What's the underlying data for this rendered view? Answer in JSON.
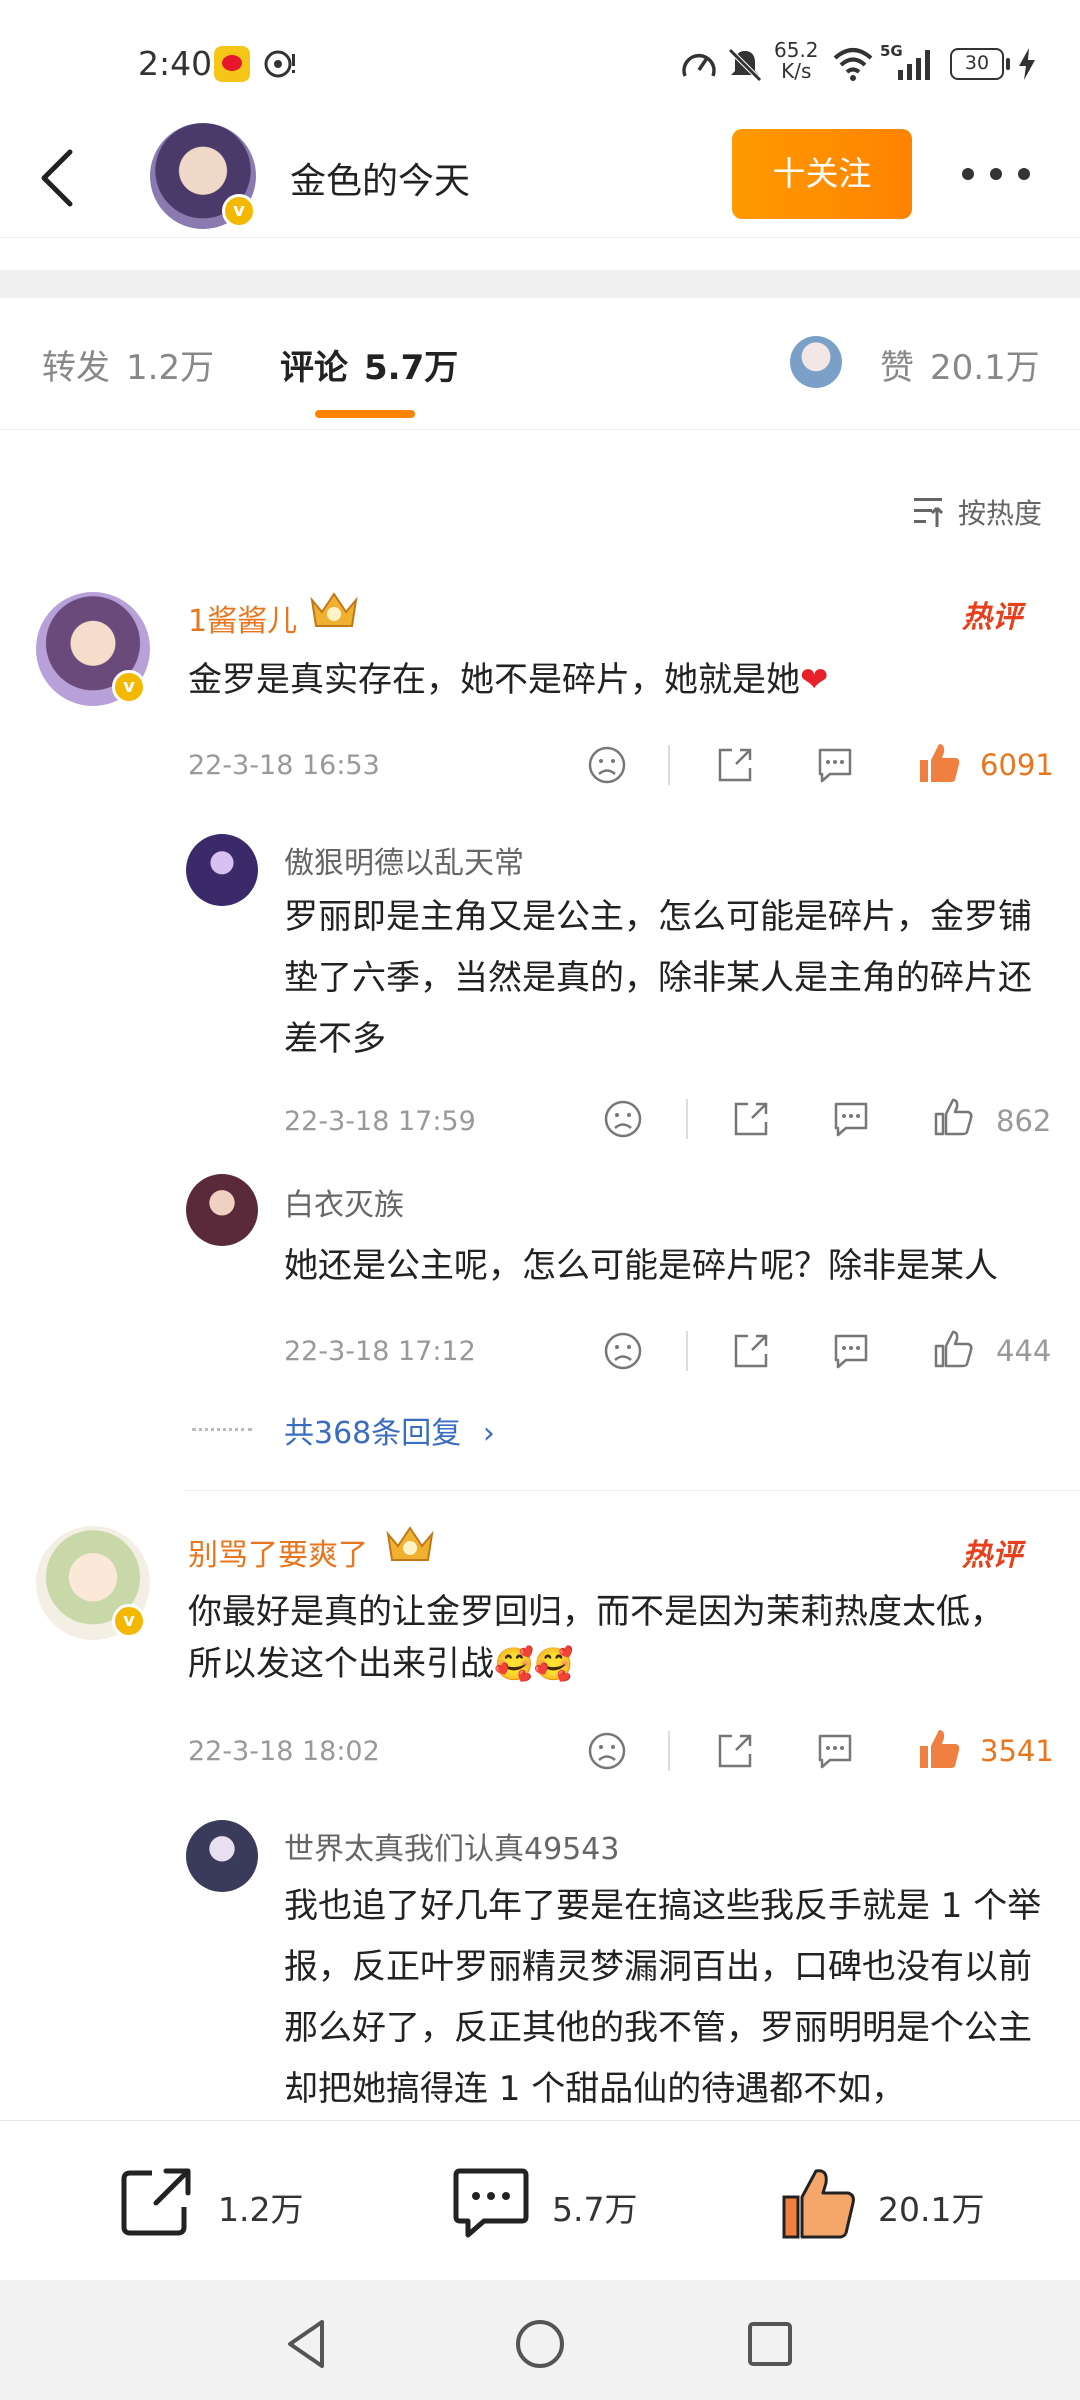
{
  "status_bar": {
    "time": "2:40",
    "net_speed_value": "65.2",
    "net_speed_unit": "K/s",
    "signal_type": "5G",
    "battery": "30"
  },
  "header": {
    "username": "金色的今天",
    "follow_label": "十关注"
  },
  "tabs": {
    "repost_label": "转发",
    "repost_count": "1.2万",
    "comment_label": "评论",
    "comment_count": "5.7万",
    "like_label": "赞",
    "like_count": "20.1万"
  },
  "sort_label": "按热度",
  "hot_badge": "热评",
  "comments": [
    {
      "name": "1酱酱儿",
      "text": "金罗是真实存在，她不是碎片，她就是她",
      "time": "22-3-18  16:53",
      "likes": "6091",
      "replies": [
        {
          "name": "傲狠明德以乱天常",
          "text": "罗丽即是主角又是公主，怎么可能是碎片，金罗铺垫了六季，当然是真的，除非某人是主角的碎片还差不多",
          "time": "22-3-18  17:59",
          "likes": "862"
        },
        {
          "name": "白衣灭族",
          "text": "她还是公主呢，怎么可能是碎片呢？除非是某人",
          "time": "22-3-18  17:12",
          "likes": "444"
        }
      ],
      "more_replies": "共368条回复"
    },
    {
      "name": "别骂了要爽了",
      "text": "你最好是真的让金罗回归，而不是因为茉莉热度太低，所以发这个出来引战",
      "time": "22-3-18  18:02",
      "likes": "3541",
      "replies": [
        {
          "name": "世界太真我们认真49543",
          "text": "我也追了好几年了要是在搞这些我反手就是 1 个举报，反正叶罗丽精灵梦漏洞百出，口碑也没有以前那么好了，反正其他的我不管，罗丽明明是个公主却把她搞得连 1 个甜品仙的待遇都不如，"
        }
      ]
    }
  ],
  "bottom_bar": {
    "repost_count": "1.2万",
    "comment_count": "5.7万",
    "like_count": "20.1万"
  },
  "colors": {
    "accent": "#ff8200",
    "hot_name": "#e8761e",
    "hot_badge": "#e8401c",
    "link": "#3a6cbf"
  }
}
